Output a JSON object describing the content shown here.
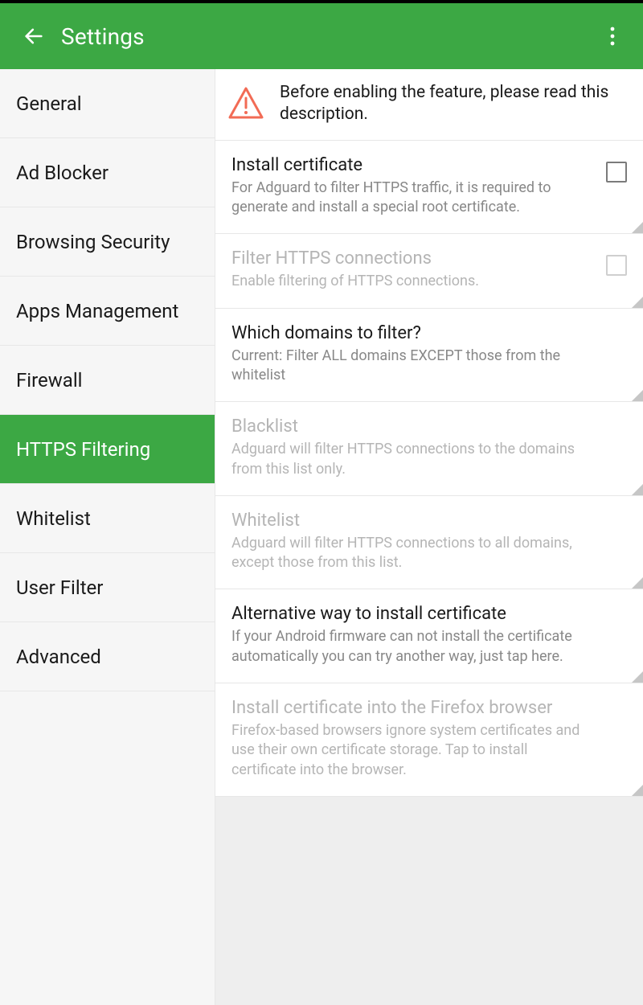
{
  "header": {
    "title": "Settings"
  },
  "sidebar": {
    "items": [
      {
        "label": "General",
        "selected": false
      },
      {
        "label": "Ad Blocker",
        "selected": false
      },
      {
        "label": "Browsing Security",
        "selected": false
      },
      {
        "label": "Apps Management",
        "selected": false
      },
      {
        "label": "Firewall",
        "selected": false
      },
      {
        "label": "HTTPS Filtering",
        "selected": true
      },
      {
        "label": "Whitelist",
        "selected": false
      },
      {
        "label": "User Filter",
        "selected": false
      },
      {
        "label": "Advanced",
        "selected": false
      }
    ]
  },
  "notice": {
    "text": "Before enabling the feature, please read this description."
  },
  "settings": [
    {
      "key": "install-cert",
      "title": "Install certificate",
      "desc": "For Adguard to filter HTTPS traffic, it is required to generate and install a special root certificate.",
      "checkbox": true,
      "checked": false,
      "disabled": false
    },
    {
      "key": "filter-https",
      "title": "Filter HTTPS connections",
      "desc": "Enable filtering of HTTPS connections.",
      "checkbox": true,
      "checked": false,
      "disabled": true
    },
    {
      "key": "which-domains",
      "title": "Which domains to filter?",
      "desc": "Current: Filter ALL domains EXCEPT those from the whitelist",
      "checkbox": false,
      "disabled": false
    },
    {
      "key": "blacklist",
      "title": "Blacklist",
      "desc": "Adguard will filter HTTPS connections to the domains from this list only.",
      "checkbox": false,
      "disabled": true
    },
    {
      "key": "whitelist",
      "title": "Whitelist",
      "desc": "Adguard will filter HTTPS connections to all domains, except those from this list.",
      "checkbox": false,
      "disabled": true
    },
    {
      "key": "alt-install",
      "title": "Alternative way to install certificate",
      "desc": "If your Android firmware can not install the certificate automatically you can try another way, just tap here.",
      "checkbox": false,
      "disabled": false
    },
    {
      "key": "firefox-install",
      "title": "Install certificate into the Firefox browser",
      "desc": "Firefox-based browsers ignore system certificates and use their own certificate storage. Tap to install certificate into the browser.",
      "checkbox": false,
      "disabled": true
    }
  ]
}
